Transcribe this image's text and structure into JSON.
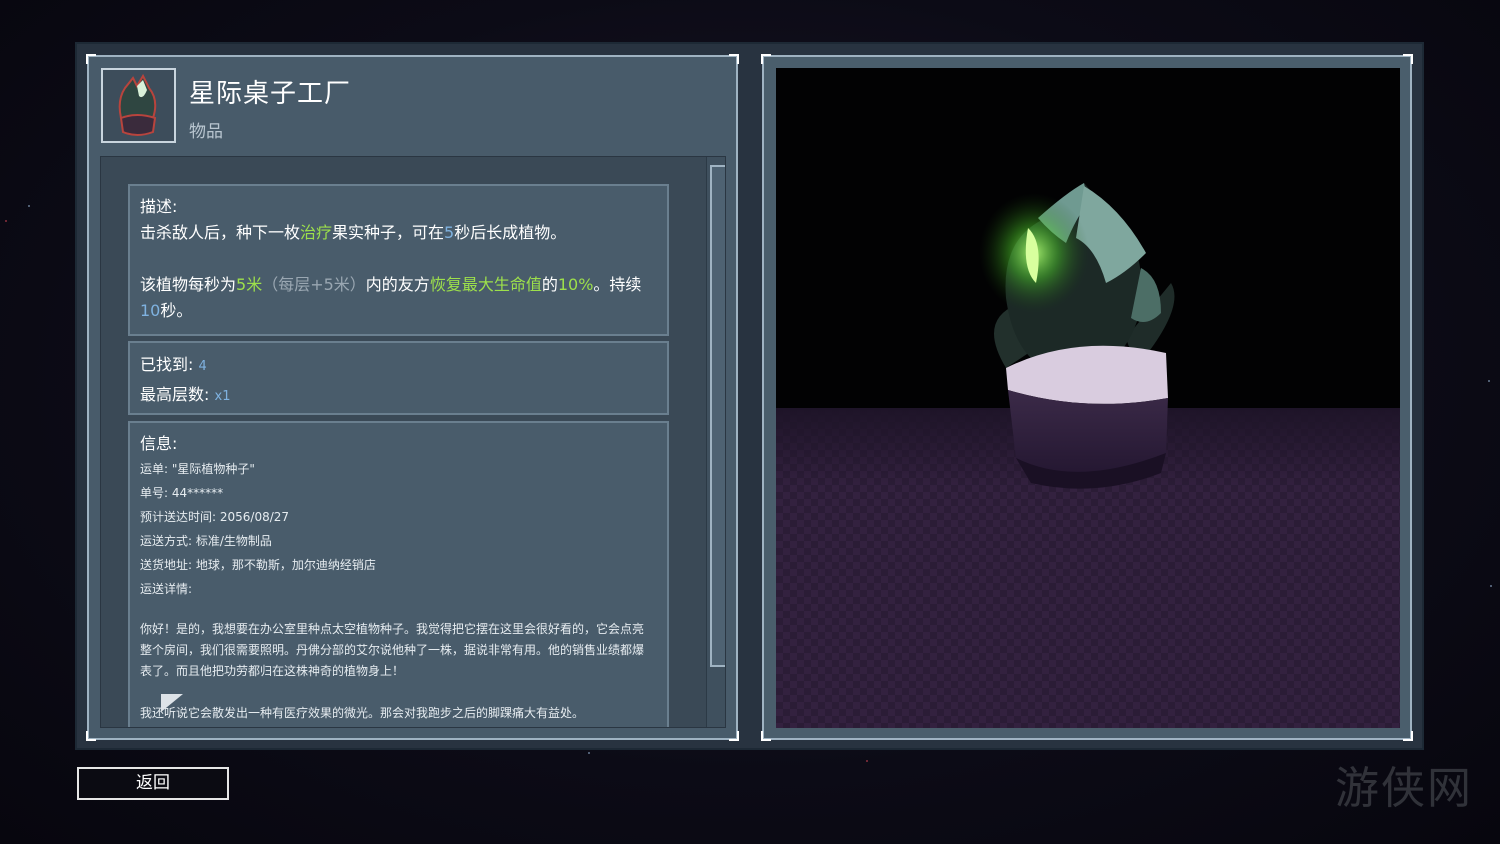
{
  "item": {
    "title": "星际桌子工厂",
    "category": "物品",
    "icon": "plant-seed-icon"
  },
  "description": {
    "heading": "描述:",
    "line1_a": "击杀敌人后，种下一枚",
    "line1_heal": "治疗",
    "line1_b": "果实种子，可在",
    "line1_secs": "5",
    "line1_c": "秒后长成植物。",
    "line2_a": "该植物每秒为",
    "line2_range": "5米",
    "line2_stack": "（每层+5米）",
    "line2_b": "内的友方",
    "line2_effect": "恢复最大生命值",
    "line2_c": "的",
    "line2_pct": "10%",
    "line2_d": "。持续",
    "line3_secs": "10",
    "line3_a": "秒。"
  },
  "stats": {
    "found_label": "已找到:",
    "found_value": "4",
    "max_label": "最高层数:",
    "max_value": "x1"
  },
  "info": {
    "heading": "信息:",
    "waybill": "运单: \"星际植物种子\"",
    "order_no": "单号: 44******",
    "eta": "预计送达时间: 2056/08/27",
    "shipping": "运送方式: 标准/生物制品",
    "address": "送货地址: 地球，那不勒斯，加尔迪纳经销店",
    "details": "运送详情:",
    "para1": "你好！是的，我想要在办公室里种点太空植物种子。我觉得把它摆在这里会很好看的，它会点亮整个房间，我们很需要照明。丹佛分部的艾尔说他种了一株，据说非常有用。他的销售业绩都爆表了。而且他把功劳都归在这株神奇的植物身上！",
    "para2": "我还听说它会散发出一种有医疗效果的微光。那会对我跑步之后的脚踝痛大有益处。"
  },
  "footer": {
    "back_label": "返回"
  },
  "colors": {
    "highlight_green": "#9de04b",
    "highlight_blue": "#7fb2e0",
    "panel": "#485b6a"
  }
}
